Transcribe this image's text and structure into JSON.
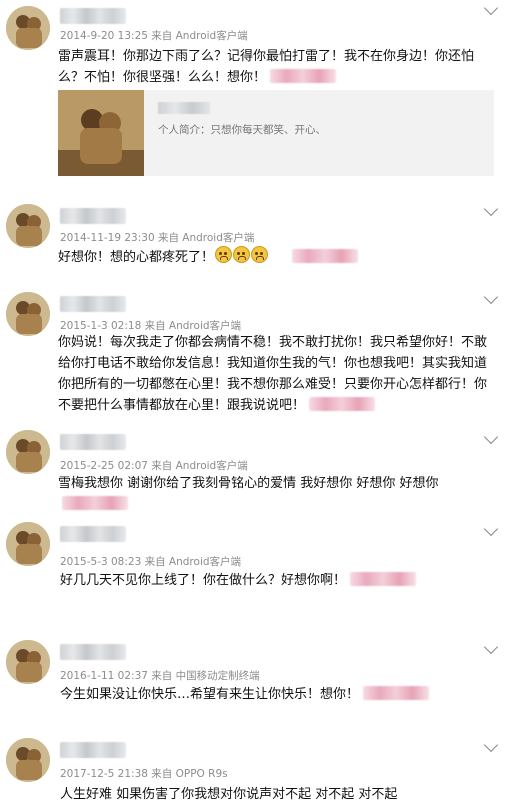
{
  "card_intro": "个人简介：只想你每天都笑、开心、",
  "posts": [
    {
      "meta": "2014-9-20 13:25 来自 Android客户端",
      "text": "雷声震耳！你那边下雨了么？记得你最怕打雷了！我不在你身边！你还怕么？不怕！你很坚强！么么！想你！"
    },
    {
      "meta": "2014-11-19 23:30 来自 Android客户端",
      "text": "好想你！想的心都疼死了！"
    },
    {
      "meta": "2015-1-3 02:18 来自 Android客户端",
      "text": "你妈说！每次我走了你都会病情不稳！我不敢打扰你！我只希望你好！不敢给你打电话不敢给你发信息！我知道你生我的气！你也想我吧！其实我知道你把所有的一切都憋在心里！我不想你那么难受！只要你开心怎样都行！你不要把什么事情都放在心里！跟我说说吧！"
    },
    {
      "meta": "2015-2-25 02:07 来自 Android客户端",
      "text": "雪梅我想你 谢谢你给了我刻骨铭心的爱情 我好想你 好想你 好想你"
    },
    {
      "meta": "2015-5-3 08:23 来自 Android客户端",
      "text": "好几几天不见你上线了！你在做什么？好想你啊！"
    },
    {
      "meta": "2016-1-11 02:37 来自 中国移动定制终端",
      "text": "今生如果没让你快乐…希望有来生让你快乐！想你！"
    },
    {
      "meta": "2017-12-5 21:38 来自 OPPO R9s",
      "text": "人生好难 如果伤害了你我想对你说声对不起 对不起 对不起"
    }
  ]
}
